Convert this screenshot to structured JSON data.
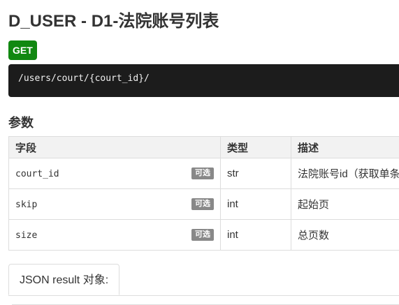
{
  "page": {
    "title": "D_USER - D1-法院账号列表",
    "method": "GET",
    "url": "/users/court/{court_id}/"
  },
  "params_section": {
    "title": "参数",
    "columns": [
      "字段",
      "类型",
      "描述"
    ],
    "rows": [
      {
        "field": "court_id",
        "badge": "可选",
        "type": "str",
        "desc": "法院账号id（获取单条"
      },
      {
        "field": "skip",
        "badge": "可选",
        "type": "int",
        "desc": "起始页"
      },
      {
        "field": "size",
        "badge": "可选",
        "type": "int",
        "desc": "总页数"
      }
    ]
  },
  "result_tabs": {
    "items": [
      "JSON result 对象:"
    ]
  }
}
